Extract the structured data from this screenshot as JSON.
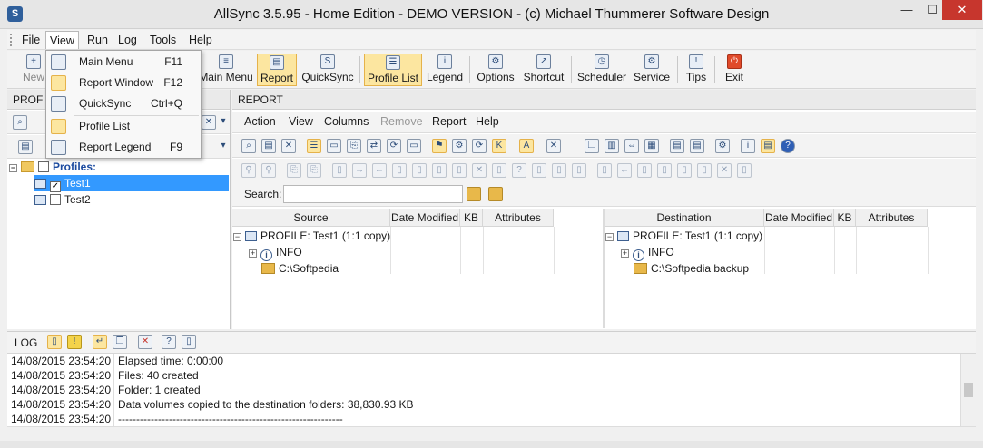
{
  "window": {
    "title": "AllSync 3.5.95 - Home Edition - DEMO VERSION - (c) Michael Thummerer Software Design",
    "min": "—",
    "max": "☐",
    "close": "✕"
  },
  "menubar": [
    "File",
    "View",
    "Run",
    "Log",
    "Tools",
    "Help"
  ],
  "view_menu": [
    {
      "label": "Main Menu",
      "key": "F11"
    },
    {
      "label": "Report Window",
      "key": "F12"
    },
    {
      "label": "QuickSync",
      "key": "Ctrl+Q"
    },
    {
      "label": "Profile List",
      "key": ""
    },
    {
      "label": "Report Legend",
      "key": "F9"
    }
  ],
  "toolbar": {
    "new": "New",
    "main_menu": "Main Menu",
    "report": "Report",
    "quicksync": "QuickSync",
    "profile_list": "Profile List",
    "legend": "Legend",
    "options": "Options",
    "shortcut": "Shortcut",
    "scheduler": "Scheduler",
    "service": "Service",
    "tips": "Tips",
    "exit": "Exit"
  },
  "left_panel": {
    "header": "PROF",
    "tree": {
      "root": "Profiles:",
      "items": [
        "Test1",
        "Test2"
      ]
    }
  },
  "report": {
    "header": "REPORT",
    "menu": [
      "Action",
      "View",
      "Columns",
      "Remove",
      "Report",
      "Help"
    ],
    "search_label": "Search:",
    "search_value": "",
    "source": {
      "columns": [
        "Source",
        "Date Modified",
        "KB",
        "Attributes"
      ],
      "rows": [
        "PROFILE: Test1   (1:1 copy)",
        "INFO",
        "C:\\Softpedia"
      ]
    },
    "destination": {
      "columns": [
        "Destination",
        "Date Modified",
        "KB",
        "Attributes"
      ],
      "rows": [
        "PROFILE: Test1   (1:1 copy)",
        "INFO",
        "C:\\Softpedia backup"
      ]
    }
  },
  "log": {
    "label": "LOG",
    "rows": [
      {
        "ts": "14/08/2015 23:54:20",
        "msg": "Elapsed time: 0:00:00"
      },
      {
        "ts": "14/08/2015 23:54:20",
        "msg": "Files: 40 created"
      },
      {
        "ts": "14/08/2015 23:54:20",
        "msg": "Folder: 1 created"
      },
      {
        "ts": "14/08/2015 23:54:20",
        "msg": "Data volumes copied to the destination folders: 38,830.93 KB"
      },
      {
        "ts": "14/08/2015 23:54:20",
        "msg": "--------------------------------------------------------------"
      }
    ]
  }
}
